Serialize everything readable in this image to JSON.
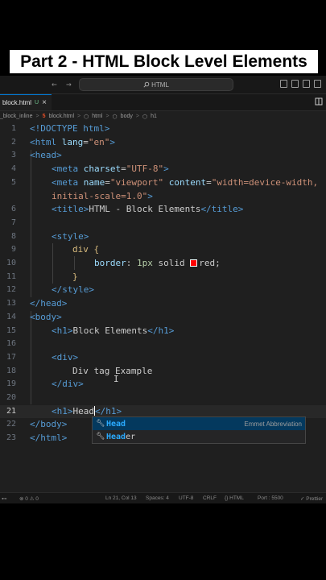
{
  "video_title": "Part 2 - HTML Block Level Elements",
  "titlebar": {
    "search_text": "HTML",
    "back_arrow": "←",
    "forward_arrow": "→"
  },
  "tab": {
    "filename": "block.html",
    "status": "U",
    "close": "×"
  },
  "breadcrumb": {
    "crumb1": "_block_inline",
    "crumb2": "block.html",
    "crumb3": "html",
    "crumb4": "body",
    "crumb5": "h1",
    "sep": ">"
  },
  "code": {
    "l1": "<!DOCTYPE html>",
    "l2_tag_open": "<html ",
    "l2_attr": "lang",
    "l2_val": "\"en\"",
    "l2_close": ">",
    "l3": "<head>",
    "l4_tag": "<meta ",
    "l4_attr": "charset",
    "l4_val": "\"UTF-8\"",
    "l4_close": ">",
    "l5_tag": "<meta ",
    "l5_attr1": "name",
    "l5_val1": "\"viewport\"",
    "l5_attr2": " content",
    "l5_val2": "\"width=device-width,",
    "l5b_val": "initial-scale=1.0\"",
    "l5b_close": ">",
    "l6_open": "<title>",
    "l6_text": "HTML - Block Elements",
    "l6_close": "</title>",
    "l8": "<style>",
    "l9": "div {",
    "l10_prop": "border",
    "l10_num": "1px",
    "l10_kw": " solid ",
    "l10_color": "red;",
    "l11": "}",
    "l12": "</style>",
    "l13": "</head>",
    "l14": "<body>",
    "l15_open": "<h1>",
    "l15_text": "Block Elements",
    "l15_close": "</h1>",
    "l17": "<div>",
    "l18": "Div tag Example",
    "l19": "</div>",
    "l21_open": "<h1>",
    "l21_text": "Head",
    "l21_close": "</h1>",
    "l22": "</body>",
    "l23": "</html>"
  },
  "line_numbers": [
    "1",
    "2",
    "3",
    "4",
    "5",
    "6",
    "7",
    "8",
    "9",
    "10",
    "11",
    "12",
    "13",
    "14",
    "15",
    "16",
    "17",
    "18",
    "19",
    "20",
    "21",
    "22",
    "23"
  ],
  "suggestions": [
    {
      "match": "Head",
      "rest": "",
      "detail": "Emmet Abbreviation",
      "icon": "wrench-icon"
    },
    {
      "match": "Head",
      "rest": "er",
      "detail": "",
      "icon": "wrench-icon"
    }
  ],
  "statusbar": {
    "errors": "⊗ 0 ⚠ 0",
    "position": "Ln 21, Col 13",
    "spaces": "Spaces: 4",
    "encoding": "UTF-8",
    "eol": "CRLF",
    "language": "{} HTML",
    "port": "Port : 5500",
    "prettier": "✓ Prettier"
  },
  "colors": {
    "editor_bg": "#1f1f1f",
    "tag": "#569cd6",
    "attr": "#9cdcfe",
    "string": "#ce9178",
    "number": "#b5cea8",
    "swatch": "#ff0000"
  }
}
